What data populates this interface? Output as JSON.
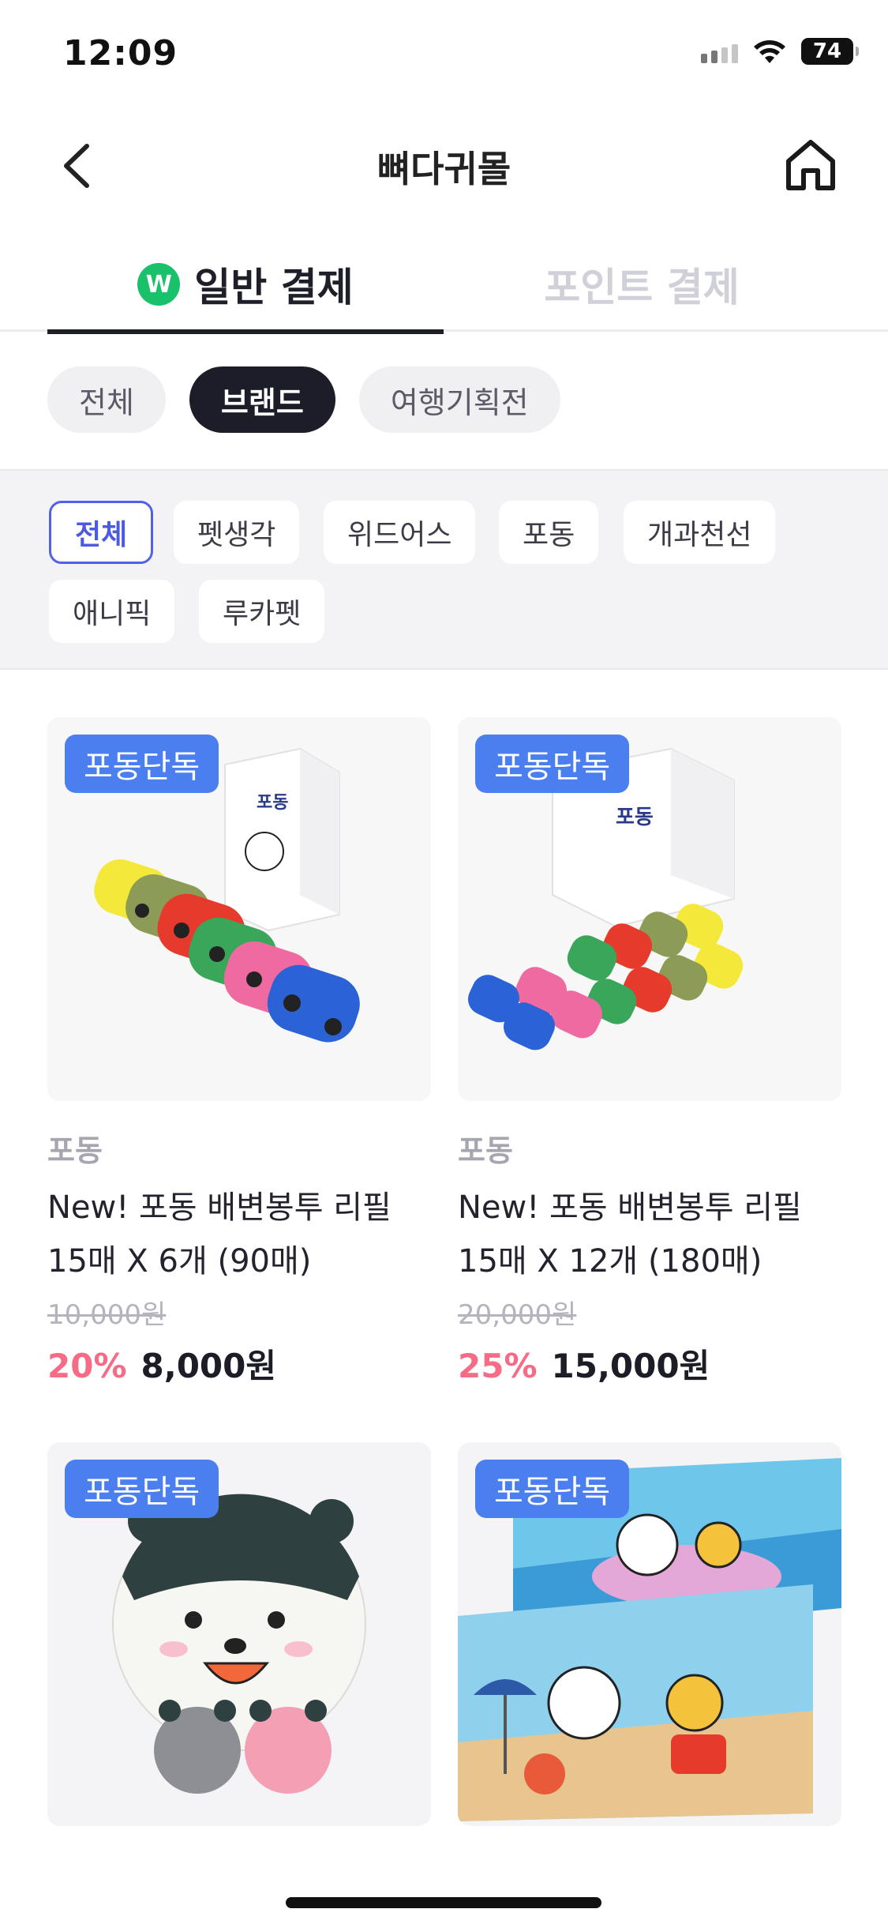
{
  "status": {
    "time": "12:09",
    "battery": "74"
  },
  "nav": {
    "title": "뼈다귀몰"
  },
  "payment_tabs": [
    {
      "label": "일반 결제",
      "badge": "W",
      "active": true
    },
    {
      "label": "포인트 결제",
      "active": false
    }
  ],
  "categories": [
    "전체",
    "브랜드",
    "여행기획전"
  ],
  "active_category": "브랜드",
  "brands": [
    "전체",
    "펫생각",
    "위드어스",
    "포동",
    "개과천선",
    "애니픽",
    "루카펫"
  ],
  "active_brand": "전체",
  "products": [
    {
      "badge": "포동단독",
      "brand": "포동",
      "name": "New! 포동 배변봉투 리필 15매 X 6개 (90매)",
      "original_price": "10,000원",
      "discount": "20%",
      "price": "8,000원"
    },
    {
      "badge": "포동단독",
      "brand": "포동",
      "name": "New! 포동 배변봉투 리필 15매 X 12개 (180매)",
      "original_price": "20,000원",
      "discount": "25%",
      "price": "15,000원"
    },
    {
      "badge": "포동단독"
    },
    {
      "badge": "포동단독"
    }
  ],
  "colors": {
    "accent_blue": "#4b7ff0",
    "discount_pink": "#f56c86",
    "tab_green": "#19c16a",
    "chip_active": "#1c1d28"
  }
}
